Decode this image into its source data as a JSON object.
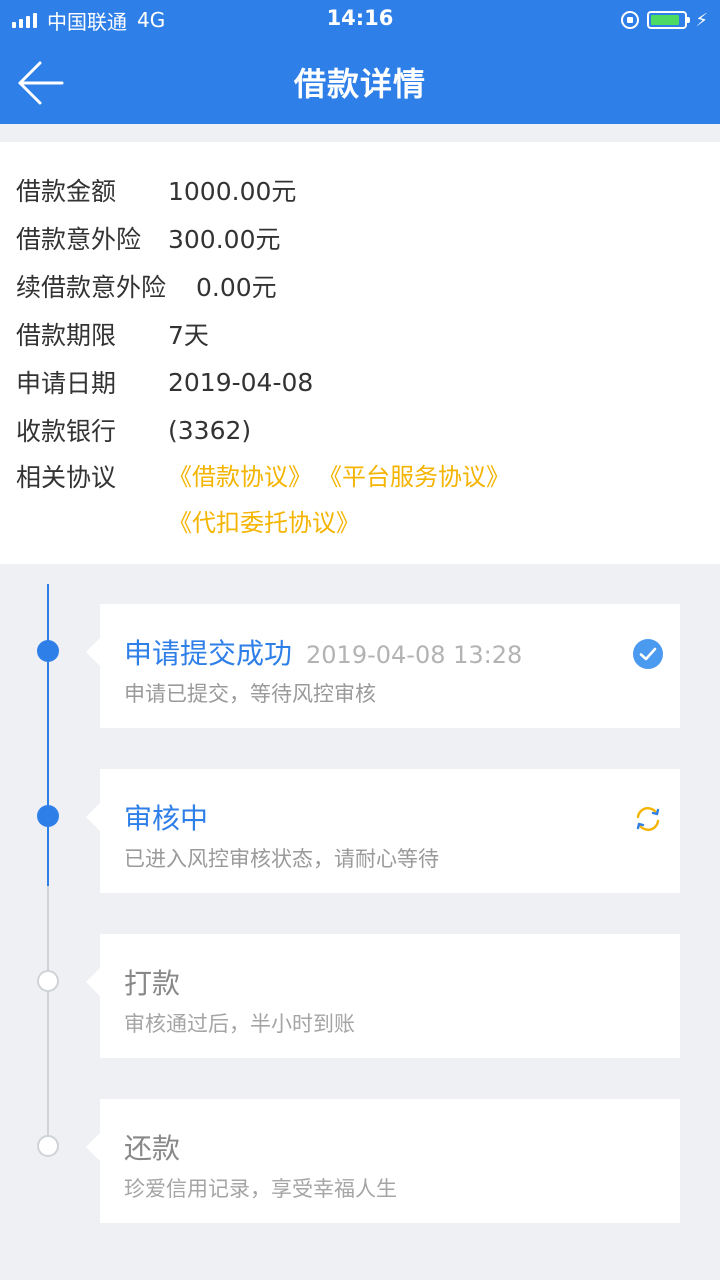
{
  "statusbar": {
    "carrier": "中国联通",
    "network": "4G",
    "time": "14:16"
  },
  "nav": {
    "title": "借款详情"
  },
  "details": [
    {
      "label": "借款金额",
      "value": "1000.00元"
    },
    {
      "label": "借款意外险",
      "value": "300.00元"
    },
    {
      "label": "续借款意外险",
      "value": "0.00元"
    },
    {
      "label": "借款期限",
      "value": "7天"
    },
    {
      "label": "申请日期",
      "value": "2019-04-08"
    },
    {
      "label": "收款银行",
      "value": "(3362)"
    }
  ],
  "agreements": {
    "label": "相关协议",
    "items": [
      "《借款协议》",
      "《平台服务协议》",
      "《代扣委托协议》"
    ]
  },
  "colors": {
    "primary": "#2f7fe8",
    "accent": "#f4b400",
    "inactive": "#cfd3d8"
  },
  "timeline": [
    {
      "title": "申请提交成功",
      "time": "2019-04-08 13:28",
      "desc": "申请已提交，等待风控审核",
      "state": "done",
      "icon": "check-circle-icon"
    },
    {
      "title": "审核中",
      "time": "",
      "desc": "已进入风控审核状态，请耐心等待",
      "state": "active",
      "icon": "refresh-icon"
    },
    {
      "title": "打款",
      "time": "",
      "desc": "审核通过后，半小时到账",
      "state": "pending",
      "icon": ""
    },
    {
      "title": "还款",
      "time": "",
      "desc": "珍爱信用记录，享受幸福人生",
      "state": "pending",
      "icon": ""
    }
  ]
}
